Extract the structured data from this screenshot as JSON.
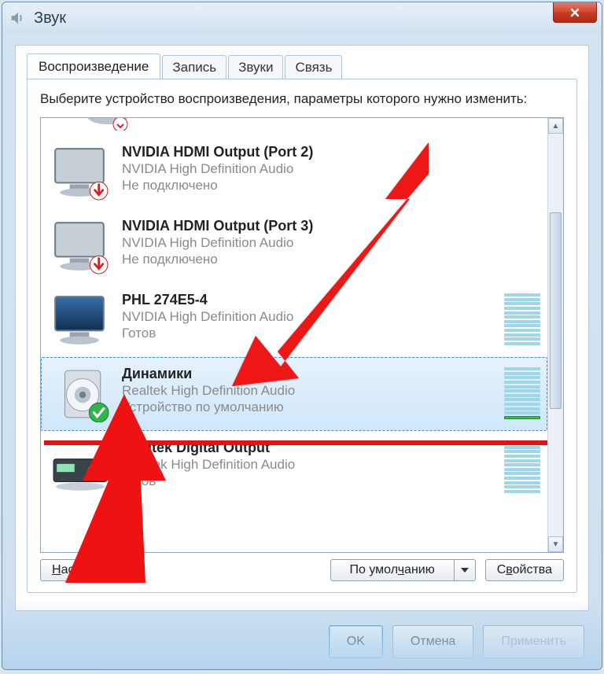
{
  "window": {
    "title": "Звук"
  },
  "tabs": {
    "playback": "Воспроизведение",
    "recording": "Запись",
    "sounds": "Звуки",
    "communications": "Связь"
  },
  "instruction": "Выберите устройство воспроизведения, параметры которого нужно изменить:",
  "devices": [
    {
      "name": "NVIDIA HDMI Output (Port 2)",
      "driver": "NVIDIA High Definition Audio",
      "status": "Не подключено",
      "icon": "monitor-off",
      "badge": "down"
    },
    {
      "name": "NVIDIA HDMI Output (Port 3)",
      "driver": "NVIDIA High Definition Audio",
      "status": "Не подключено",
      "icon": "monitor-off",
      "badge": "down"
    },
    {
      "name": "PHL 274E5-4",
      "driver": "NVIDIA High Definition Audio",
      "status": "Готов",
      "icon": "monitor-on",
      "meter": true
    },
    {
      "name": "Динамики",
      "driver": "Realtek High Definition Audio",
      "status": "Устройство по умолчанию",
      "icon": "speaker",
      "badge": "check",
      "meter": true,
      "selected": true,
      "active_bar": true
    },
    {
      "name": "Realtek Digital Output",
      "driver": "Realtek High Definition Audio",
      "status": "Готов",
      "icon": "receiver",
      "meter": true
    }
  ],
  "buttons": {
    "configure": "Настроить",
    "default": "По умолчанию",
    "properties": "Свойства",
    "ok": "OK",
    "cancel": "Отмена",
    "apply": "Применить"
  }
}
